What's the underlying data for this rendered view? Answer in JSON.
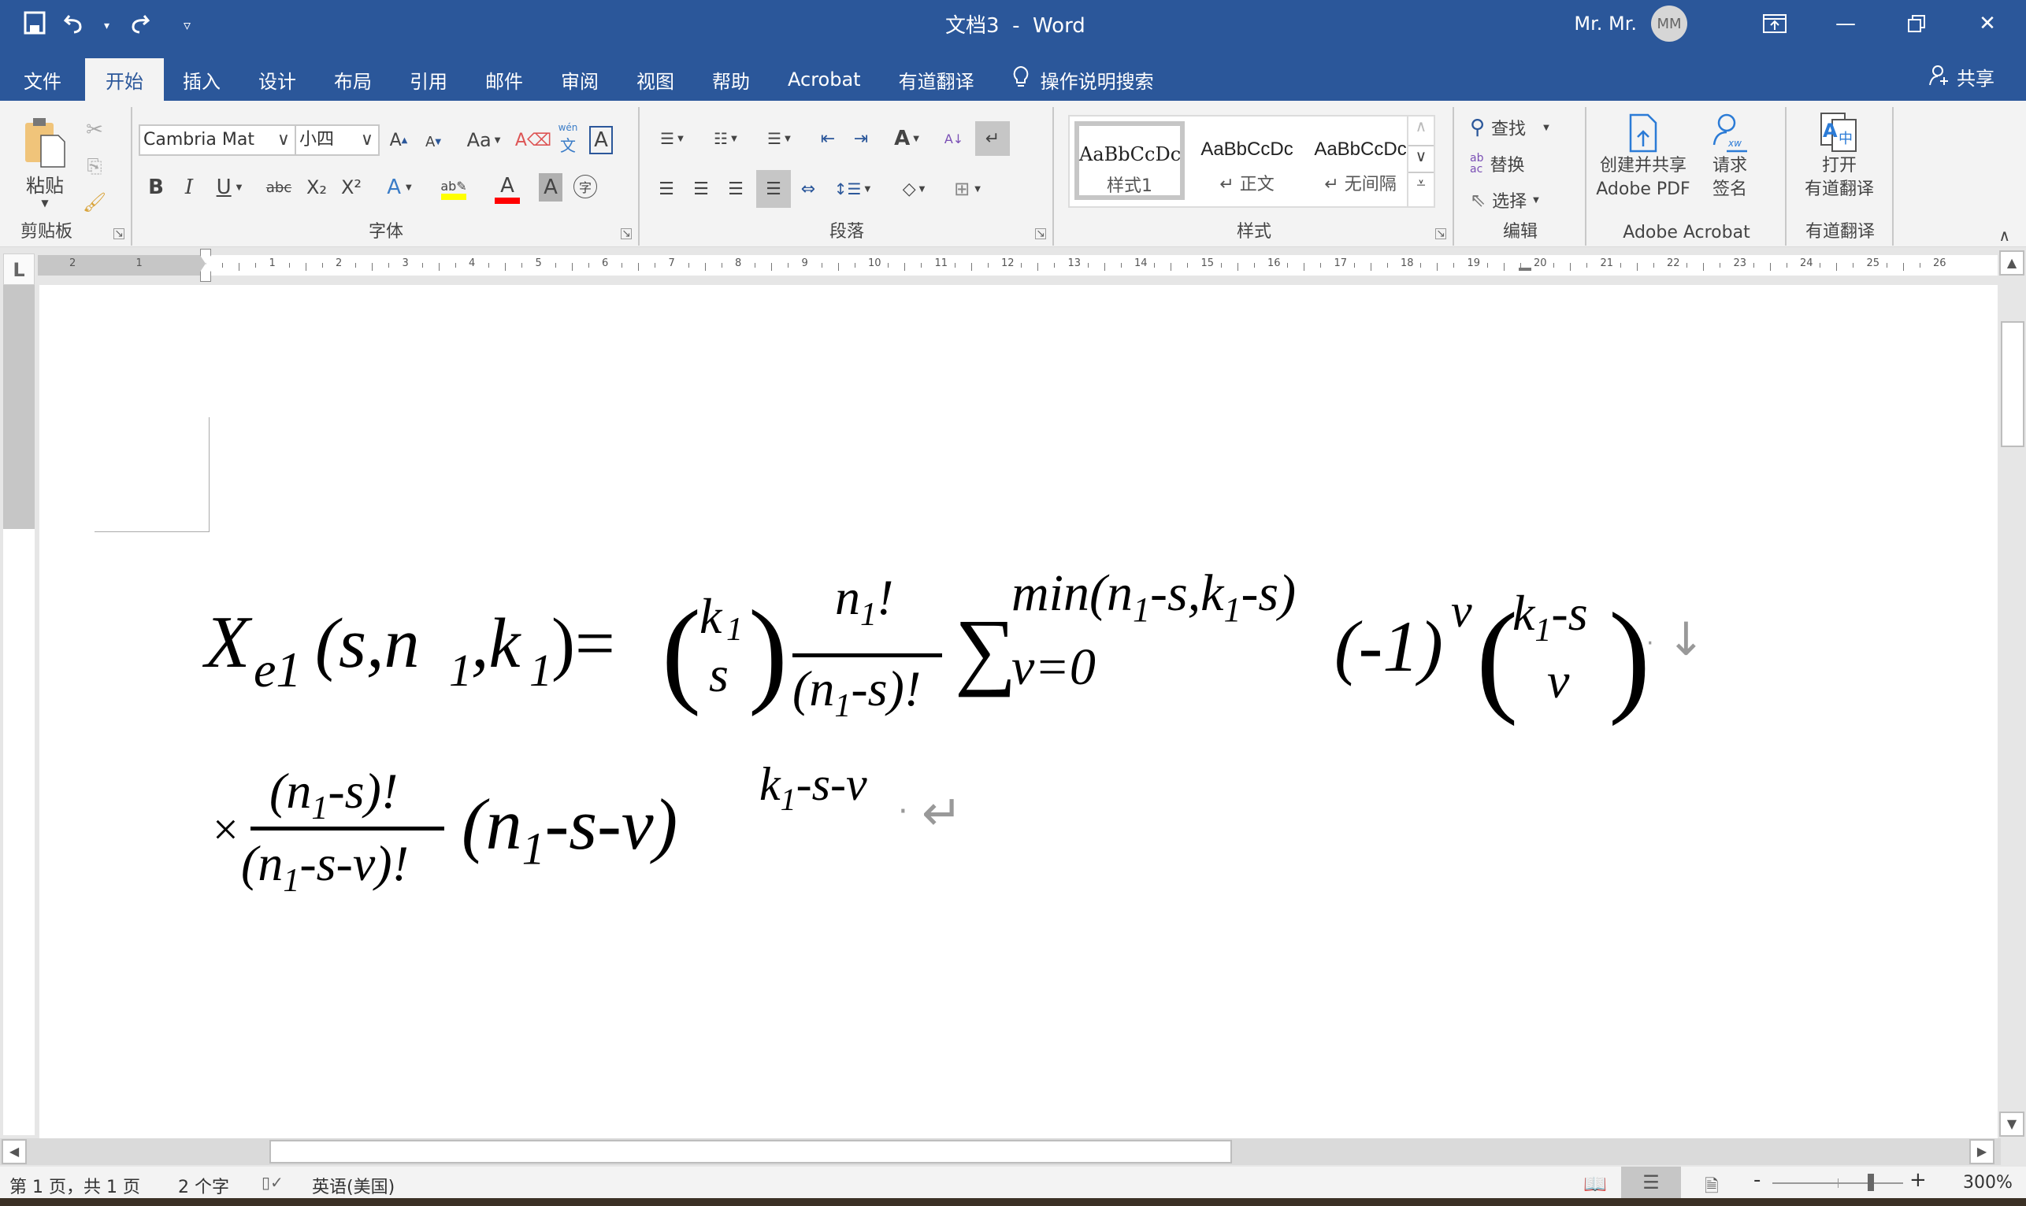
{
  "window": {
    "title": "文档3  -  Word",
    "user_name": "Mr. Mr.",
    "avatar_initials": "MM",
    "accent_color": "#2b579a"
  },
  "qat": {
    "save_icon": "save-icon",
    "undo_icon": "undo-icon",
    "redo_icon": "redo-icon",
    "customize_icon": "customize-qat-icon"
  },
  "tabs": [
    "文件",
    "开始",
    "插入",
    "设计",
    "布局",
    "引用",
    "邮件",
    "审阅",
    "视图",
    "帮助",
    "Acrobat",
    "有道翻译"
  ],
  "active_tab": "开始",
  "tell_me": "操作说明搜索",
  "share": "共享",
  "ribbon": {
    "clipboard": {
      "label": "剪贴板",
      "paste": "粘贴"
    },
    "font": {
      "label": "字体",
      "font_name": "Cambria Mat",
      "font_size": "小四",
      "grow": "A",
      "shrink": "A",
      "change_case": "Aa",
      "bold": "B",
      "italic": "I",
      "underline": "U",
      "strike": "abc",
      "subscript": "X₂",
      "superscript": "X²",
      "phonetic": "wén",
      "highlight_color": "#ffff00",
      "font_color": "#ff0000"
    },
    "paragraph": {
      "label": "段落"
    },
    "styles": {
      "label": "样式",
      "items": [
        {
          "preview": "AaBbCcDc",
          "name": "样式1"
        },
        {
          "preview": "AaBbCcDc",
          "name": "↵ 正文"
        },
        {
          "preview": "AaBbCcDc",
          "name": "↵ 无间隔"
        }
      ]
    },
    "editing": {
      "label": "编辑",
      "find": "查找",
      "replace": "替换",
      "select": "选择"
    },
    "acrobat": {
      "label": "Adobe Acrobat",
      "create_line1": "创建并共享",
      "create_line2": "Adobe PDF",
      "sign_line1": "请求",
      "sign_line2": "签名"
    },
    "youdao": {
      "label": "有道翻译",
      "open_line1": "打开",
      "open_line2": "有道翻译"
    }
  },
  "ruler": {
    "left_numbers": [
      "2",
      "1"
    ],
    "numbers": [
      "1",
      "2",
      "3",
      "4",
      "5",
      "6",
      "7",
      "8",
      "9",
      "10",
      "11",
      "12",
      "13",
      "14",
      "15",
      "16",
      "17",
      "18",
      "19",
      "20",
      "21",
      "22",
      "23",
      "24",
      "25",
      "26"
    ]
  },
  "document": {
    "equation_line1": {
      "lhs_X": "X",
      "lhs_sub": "e1",
      "lhs_args": "(s,n",
      "sub1": "1",
      "comma_k": ",k",
      "sub1b": "1",
      "close_eq": ")=",
      "binom1_top": "k",
      "binom1_top_sub": "1",
      "binom1_bot": "s",
      "frac1_num": "n",
      "frac1_num_sub": "1",
      "frac1_num_tail": "!",
      "frac1_den_a": "(n",
      "frac1_den_sub": "1",
      "frac1_den_b": "-s)!",
      "sum": "∑",
      "sum_upper_a": "min(n",
      "sum_upper_sub1": "1",
      "sum_upper_b": "-s,k",
      "sum_upper_sub2": "1",
      "sum_upper_c": "-s)",
      "sum_lower": "v=0",
      "neg_one": "(-1)",
      "neg_one_exp": "v",
      "binom2_top_a": "k",
      "binom2_top_sub": "1",
      "binom2_top_b": "-s",
      "binom2_bot": "v",
      "line_break_mark": "↓"
    },
    "equation_line2": {
      "times": "×",
      "frac_num_a": "(n",
      "frac_num_sub": "1",
      "frac_num_b": "-s)!",
      "frac_den_a": "(n",
      "frac_den_sub": "1",
      "frac_den_b": "-s-v)!",
      "base_a": "(n",
      "base_sub": "1",
      "base_b": "-s-v)",
      "exp_a": "k",
      "exp_sub": "1",
      "exp_b": "-s-v",
      "paragraph_mark": "↵"
    }
  },
  "status": {
    "page": "第 1 页，共 1 页",
    "words": "2 个字",
    "language": "英语(美国)",
    "zoom": "300%",
    "zoom_fraction": 0.75
  }
}
